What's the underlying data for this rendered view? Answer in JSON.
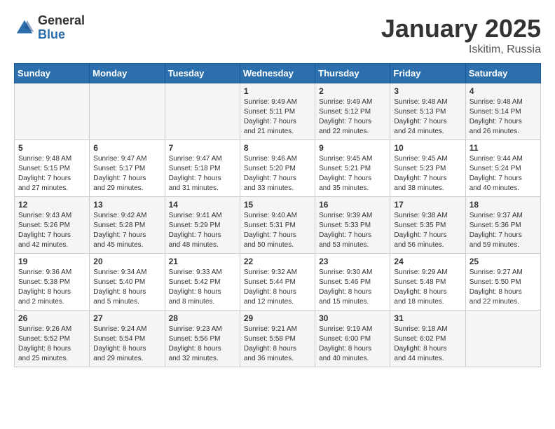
{
  "logo": {
    "general": "General",
    "blue": "Blue"
  },
  "title": "January 2025",
  "location": "Iskitim, Russia",
  "days_of_week": [
    "Sunday",
    "Monday",
    "Tuesday",
    "Wednesday",
    "Thursday",
    "Friday",
    "Saturday"
  ],
  "weeks": [
    [
      {
        "day": "",
        "content": ""
      },
      {
        "day": "",
        "content": ""
      },
      {
        "day": "",
        "content": ""
      },
      {
        "day": "1",
        "content": "Sunrise: 9:49 AM\nSunset: 5:11 PM\nDaylight: 7 hours\nand 21 minutes."
      },
      {
        "day": "2",
        "content": "Sunrise: 9:49 AM\nSunset: 5:12 PM\nDaylight: 7 hours\nand 22 minutes."
      },
      {
        "day": "3",
        "content": "Sunrise: 9:48 AM\nSunset: 5:13 PM\nDaylight: 7 hours\nand 24 minutes."
      },
      {
        "day": "4",
        "content": "Sunrise: 9:48 AM\nSunset: 5:14 PM\nDaylight: 7 hours\nand 26 minutes."
      }
    ],
    [
      {
        "day": "5",
        "content": "Sunrise: 9:48 AM\nSunset: 5:15 PM\nDaylight: 7 hours\nand 27 minutes."
      },
      {
        "day": "6",
        "content": "Sunrise: 9:47 AM\nSunset: 5:17 PM\nDaylight: 7 hours\nand 29 minutes."
      },
      {
        "day": "7",
        "content": "Sunrise: 9:47 AM\nSunset: 5:18 PM\nDaylight: 7 hours\nand 31 minutes."
      },
      {
        "day": "8",
        "content": "Sunrise: 9:46 AM\nSunset: 5:20 PM\nDaylight: 7 hours\nand 33 minutes."
      },
      {
        "day": "9",
        "content": "Sunrise: 9:45 AM\nSunset: 5:21 PM\nDaylight: 7 hours\nand 35 minutes."
      },
      {
        "day": "10",
        "content": "Sunrise: 9:45 AM\nSunset: 5:23 PM\nDaylight: 7 hours\nand 38 minutes."
      },
      {
        "day": "11",
        "content": "Sunrise: 9:44 AM\nSunset: 5:24 PM\nDaylight: 7 hours\nand 40 minutes."
      }
    ],
    [
      {
        "day": "12",
        "content": "Sunrise: 9:43 AM\nSunset: 5:26 PM\nDaylight: 7 hours\nand 42 minutes."
      },
      {
        "day": "13",
        "content": "Sunrise: 9:42 AM\nSunset: 5:28 PM\nDaylight: 7 hours\nand 45 minutes."
      },
      {
        "day": "14",
        "content": "Sunrise: 9:41 AM\nSunset: 5:29 PM\nDaylight: 7 hours\nand 48 minutes."
      },
      {
        "day": "15",
        "content": "Sunrise: 9:40 AM\nSunset: 5:31 PM\nDaylight: 7 hours\nand 50 minutes."
      },
      {
        "day": "16",
        "content": "Sunrise: 9:39 AM\nSunset: 5:33 PM\nDaylight: 7 hours\nand 53 minutes."
      },
      {
        "day": "17",
        "content": "Sunrise: 9:38 AM\nSunset: 5:35 PM\nDaylight: 7 hours\nand 56 minutes."
      },
      {
        "day": "18",
        "content": "Sunrise: 9:37 AM\nSunset: 5:36 PM\nDaylight: 7 hours\nand 59 minutes."
      }
    ],
    [
      {
        "day": "19",
        "content": "Sunrise: 9:36 AM\nSunset: 5:38 PM\nDaylight: 8 hours\nand 2 minutes."
      },
      {
        "day": "20",
        "content": "Sunrise: 9:34 AM\nSunset: 5:40 PM\nDaylight: 8 hours\nand 5 minutes."
      },
      {
        "day": "21",
        "content": "Sunrise: 9:33 AM\nSunset: 5:42 PM\nDaylight: 8 hours\nand 8 minutes."
      },
      {
        "day": "22",
        "content": "Sunrise: 9:32 AM\nSunset: 5:44 PM\nDaylight: 8 hours\nand 12 minutes."
      },
      {
        "day": "23",
        "content": "Sunrise: 9:30 AM\nSunset: 5:46 PM\nDaylight: 8 hours\nand 15 minutes."
      },
      {
        "day": "24",
        "content": "Sunrise: 9:29 AM\nSunset: 5:48 PM\nDaylight: 8 hours\nand 18 minutes."
      },
      {
        "day": "25",
        "content": "Sunrise: 9:27 AM\nSunset: 5:50 PM\nDaylight: 8 hours\nand 22 minutes."
      }
    ],
    [
      {
        "day": "26",
        "content": "Sunrise: 9:26 AM\nSunset: 5:52 PM\nDaylight: 8 hours\nand 25 minutes."
      },
      {
        "day": "27",
        "content": "Sunrise: 9:24 AM\nSunset: 5:54 PM\nDaylight: 8 hours\nand 29 minutes."
      },
      {
        "day": "28",
        "content": "Sunrise: 9:23 AM\nSunset: 5:56 PM\nDaylight: 8 hours\nand 32 minutes."
      },
      {
        "day": "29",
        "content": "Sunrise: 9:21 AM\nSunset: 5:58 PM\nDaylight: 8 hours\nand 36 minutes."
      },
      {
        "day": "30",
        "content": "Sunrise: 9:19 AM\nSunset: 6:00 PM\nDaylight: 8 hours\nand 40 minutes."
      },
      {
        "day": "31",
        "content": "Sunrise: 9:18 AM\nSunset: 6:02 PM\nDaylight: 8 hours\nand 44 minutes."
      },
      {
        "day": "",
        "content": ""
      }
    ]
  ]
}
